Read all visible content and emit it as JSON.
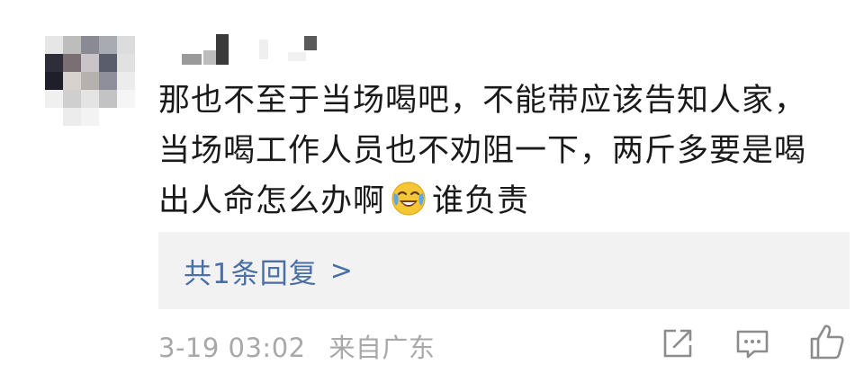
{
  "comment": {
    "text_line1": "那也不至于当场喝吧，不能带应该告知人家，",
    "text_line2": "当场喝工作人员也不劝阻一下，两斤多要是喝",
    "text_line3_before_emoji": "出人命怎么办啊",
    "emoji": "laughing-crying-emoji",
    "text_line3_after_emoji": "谁负责"
  },
  "replies": {
    "link_label": "共1条回复",
    "chevron": ">"
  },
  "meta": {
    "date": "3-19 03:02",
    "location": "来自广东"
  },
  "actions": {
    "share": "share-icon",
    "reply": "comment-icon",
    "like": "thumbs-up-icon"
  },
  "colors": {
    "text": "#1a1a1a",
    "link": "#4a6fa5",
    "meta": "#a8a8a8",
    "reply_bg": "#f2f2f2",
    "icon": "#8c8c8c"
  }
}
